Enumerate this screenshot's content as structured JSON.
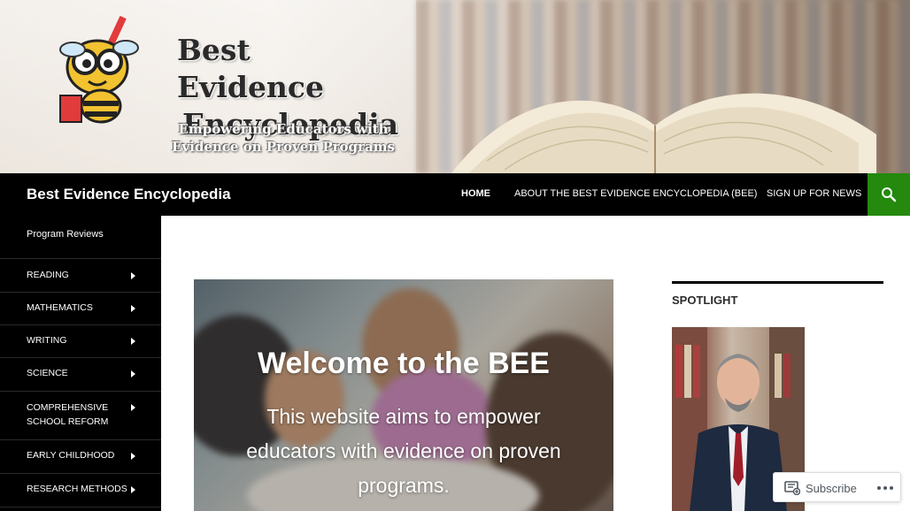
{
  "banner": {
    "logo_line1": "Best Evidence",
    "logo_line2": "Encyclopedia",
    "tagline_line1": "Empowering Educators with",
    "tagline_line2": "Evidence on Proven Programs"
  },
  "header": {
    "site_title": "Best Evidence Encyclopedia",
    "nav": {
      "home": "HOME",
      "about": "ABOUT THE BEST EVIDENCE ENCYCLOPEDIA (BEE)",
      "signup": "SIGN UP FOR NEWS"
    },
    "search_icon": "search-icon",
    "accent_color": "#24890d"
  },
  "sidebar": {
    "top_link": "Program Reviews",
    "items": [
      {
        "label": "READING"
      },
      {
        "label": "MATHEMATICS"
      },
      {
        "label": "WRITING"
      },
      {
        "label": "SCIENCE"
      },
      {
        "label": "COMPREHENSIVE SCHOOL REFORM"
      },
      {
        "label": "EARLY CHILDHOOD"
      },
      {
        "label": "RESEARCH METHODS"
      }
    ]
  },
  "hero": {
    "title": "Welcome to the BEE",
    "text": "This website aims to empower educators with evidence on proven programs."
  },
  "widget": {
    "title": "SPOTLIGHT"
  },
  "subscribe": {
    "label": "Subscribe",
    "more_icon": "ellipsis-icon"
  }
}
